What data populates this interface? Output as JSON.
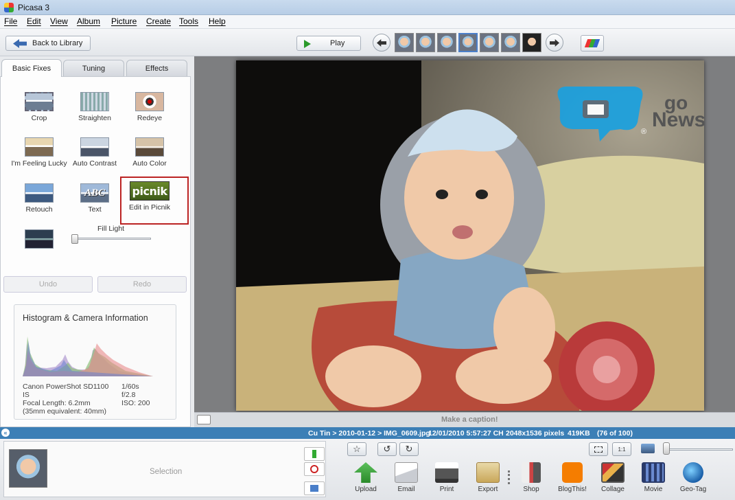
{
  "window": {
    "title": "Picasa 3"
  },
  "menu": [
    "File",
    "Edit",
    "View",
    "Album",
    "Picture",
    "Create",
    "Tools",
    "Help"
  ],
  "toolbar": {
    "back_label": "Back to Library",
    "play_label": "Play"
  },
  "tabs": [
    "Basic Fixes",
    "Tuning",
    "Effects"
  ],
  "tools": {
    "crop": "Crop",
    "straighten": "Straighten",
    "redeye": "Redeye",
    "lucky": "I'm Feeling Lucky",
    "auto_contrast": "Auto Contrast",
    "auto_color": "Auto Color",
    "retouch": "Retouch",
    "text": "Text",
    "picnik": "Edit in Picnik",
    "picnik_logo": "picnik",
    "text_icon": "ABC"
  },
  "fill_light": {
    "label": "Fill Light",
    "value": 0
  },
  "history": {
    "undo": "Undo",
    "redo": "Redo"
  },
  "histogram": {
    "title": "Histogram & Camera Information",
    "camera": "Canon PowerShot SD1100",
    "camera_line2": "IS",
    "focal": "Focal Length: 6.2mm",
    "equiv": "(35mm equivalent:  40mm)",
    "shutter": "1/60s",
    "aperture": "f/2.8",
    "iso": "ISO: 200"
  },
  "watermark": {
    "go": "go",
    "news": "News",
    "reg": "®"
  },
  "caption": {
    "placeholder": "Make a caption!"
  },
  "status": {
    "path": "Cu Tin > 2010-01-12 > IMG_0609.jpg",
    "date": "12/01/2010 5:57:27 CH",
    "dims": "2048x1536 pixels",
    "size": "419KB",
    "index": "(76 of 100)"
  },
  "tray": {
    "selection_label": "Selection"
  },
  "actions": [
    {
      "label": "Upload",
      "icon": "upload-icon"
    },
    {
      "label": "Email",
      "icon": "email-icon"
    },
    {
      "label": "Print",
      "icon": "print-icon"
    },
    {
      "label": "Export",
      "icon": "export-icon"
    },
    {
      "label": "Shop",
      "icon": "shop-icon"
    },
    {
      "label": "BlogThis!",
      "icon": "blogger-icon"
    },
    {
      "label": "Collage",
      "icon": "collage-icon"
    },
    {
      "label": "Movie",
      "icon": "movie-icon"
    },
    {
      "label": "Geo-Tag",
      "icon": "geotag-icon"
    }
  ],
  "view_buttons": {
    "fit": "1:1"
  }
}
